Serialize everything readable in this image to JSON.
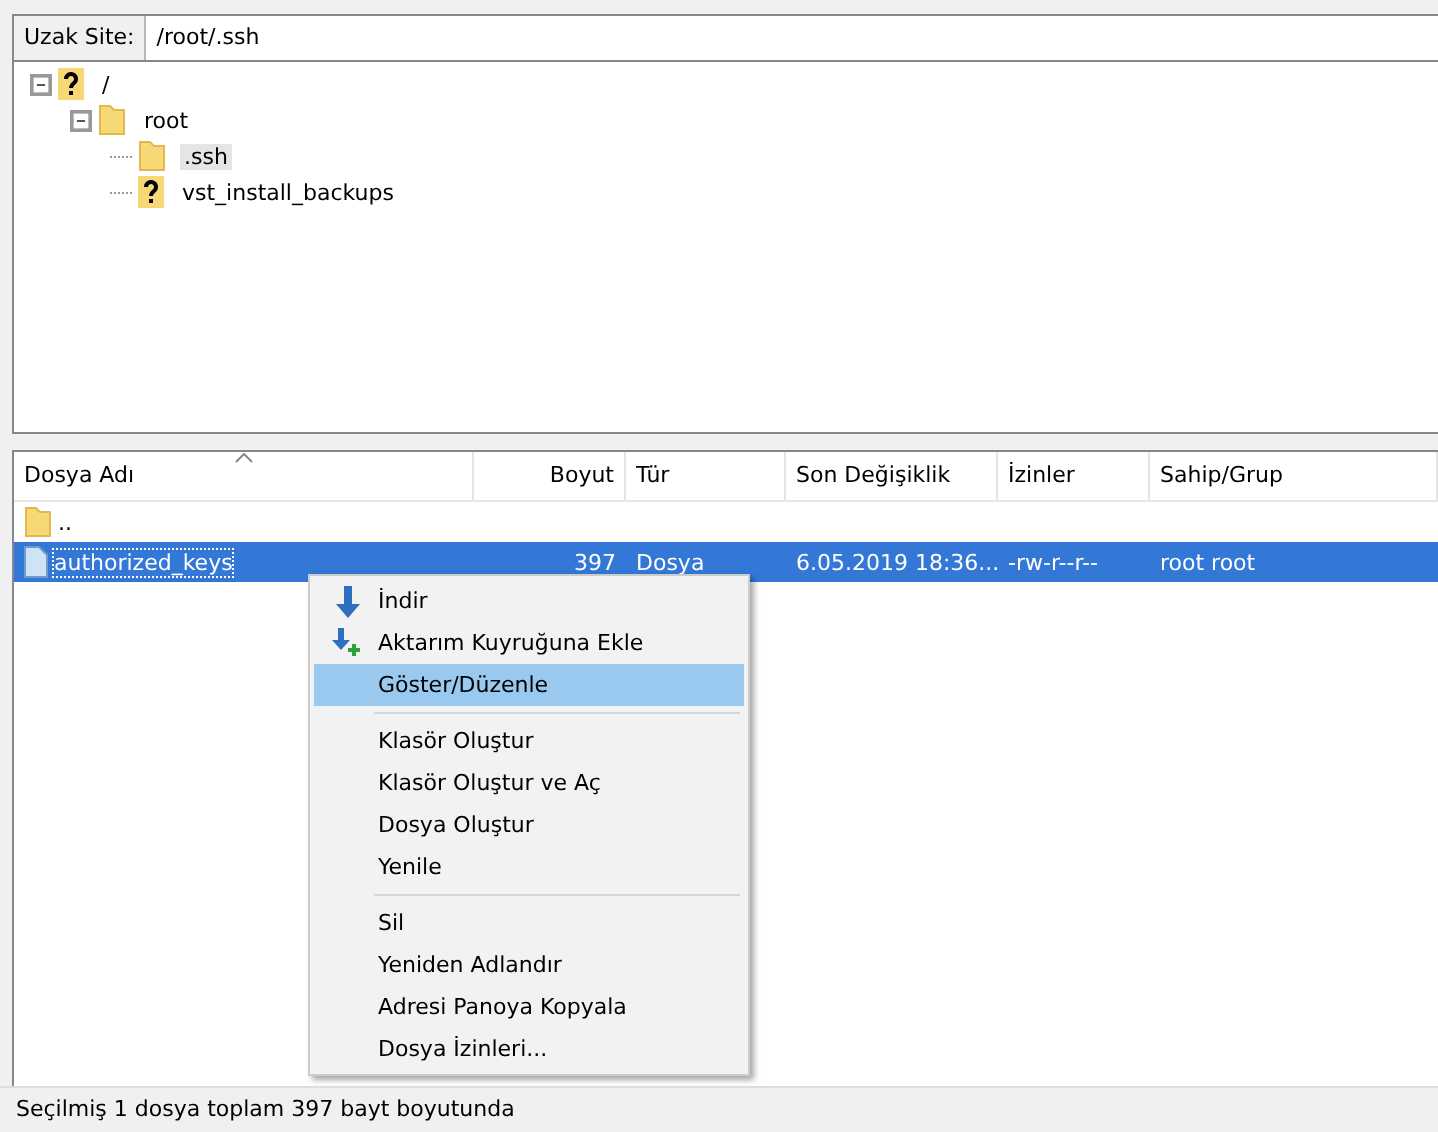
{
  "remote_site": {
    "label": "Uzak Site:",
    "path": "/root/.ssh"
  },
  "tree": [
    {
      "name": "/",
      "kind": "unknown",
      "expanded": true,
      "selected": false,
      "children": [
        {
          "name": "root",
          "kind": "folder",
          "expanded": true,
          "selected": false,
          "children": [
            {
              "name": ".ssh",
              "kind": "folder",
              "selected": true
            },
            {
              "name": "vst_install_backups",
              "kind": "unknown",
              "selected": false
            }
          ]
        }
      ]
    }
  ],
  "table": {
    "columns": [
      {
        "label": "Dosya Adı",
        "sorted": true
      },
      {
        "label": "Boyut",
        "sorted": false
      },
      {
        "label": "Tür",
        "sorted": false
      },
      {
        "label": "Son Değişiklik",
        "sorted": false
      },
      {
        "label": "İzinler",
        "sorted": false
      },
      {
        "label": "Sahip/Grup",
        "sorted": false
      }
    ],
    "rows": [
      {
        "kind": "folder",
        "selected": false,
        "cells": [
          ".."
        ]
      },
      {
        "kind": "file",
        "selected": true,
        "cells": [
          "authorized_keys",
          "397",
          "Dosya",
          "6.05.2019 18:36...",
          "-rw-r--r--",
          "root root"
        ]
      }
    ]
  },
  "context_menu": {
    "items": [
      {
        "kind": "item",
        "label": "İndir",
        "selected": false
      },
      {
        "kind": "item",
        "label": "Aktarım Kuyruğuna Ekle",
        "selected": false
      },
      {
        "kind": "item",
        "label": "Göster/Düzenle",
        "selected": true
      },
      {
        "kind": "separator"
      },
      {
        "kind": "item",
        "label": "Klasör Oluştur",
        "selected": false
      },
      {
        "kind": "item",
        "label": "Klasör Oluştur ve Aç",
        "selected": false
      },
      {
        "kind": "item",
        "label": "Dosya Oluştur",
        "selected": false
      },
      {
        "kind": "item",
        "label": "Yenile",
        "selected": false
      },
      {
        "kind": "separator"
      },
      {
        "kind": "item",
        "label": "Sil",
        "selected": false
      },
      {
        "kind": "item",
        "label": "Yeniden Adlandır",
        "selected": false
      },
      {
        "kind": "item",
        "label": "Adresi Panoya Kopyala",
        "selected": false
      },
      {
        "kind": "item",
        "label": "Dosya İzinleri...",
        "selected": false
      }
    ]
  },
  "status_bar": "Seçilmiş 1 dosya toplam 397 bayt boyutunda"
}
